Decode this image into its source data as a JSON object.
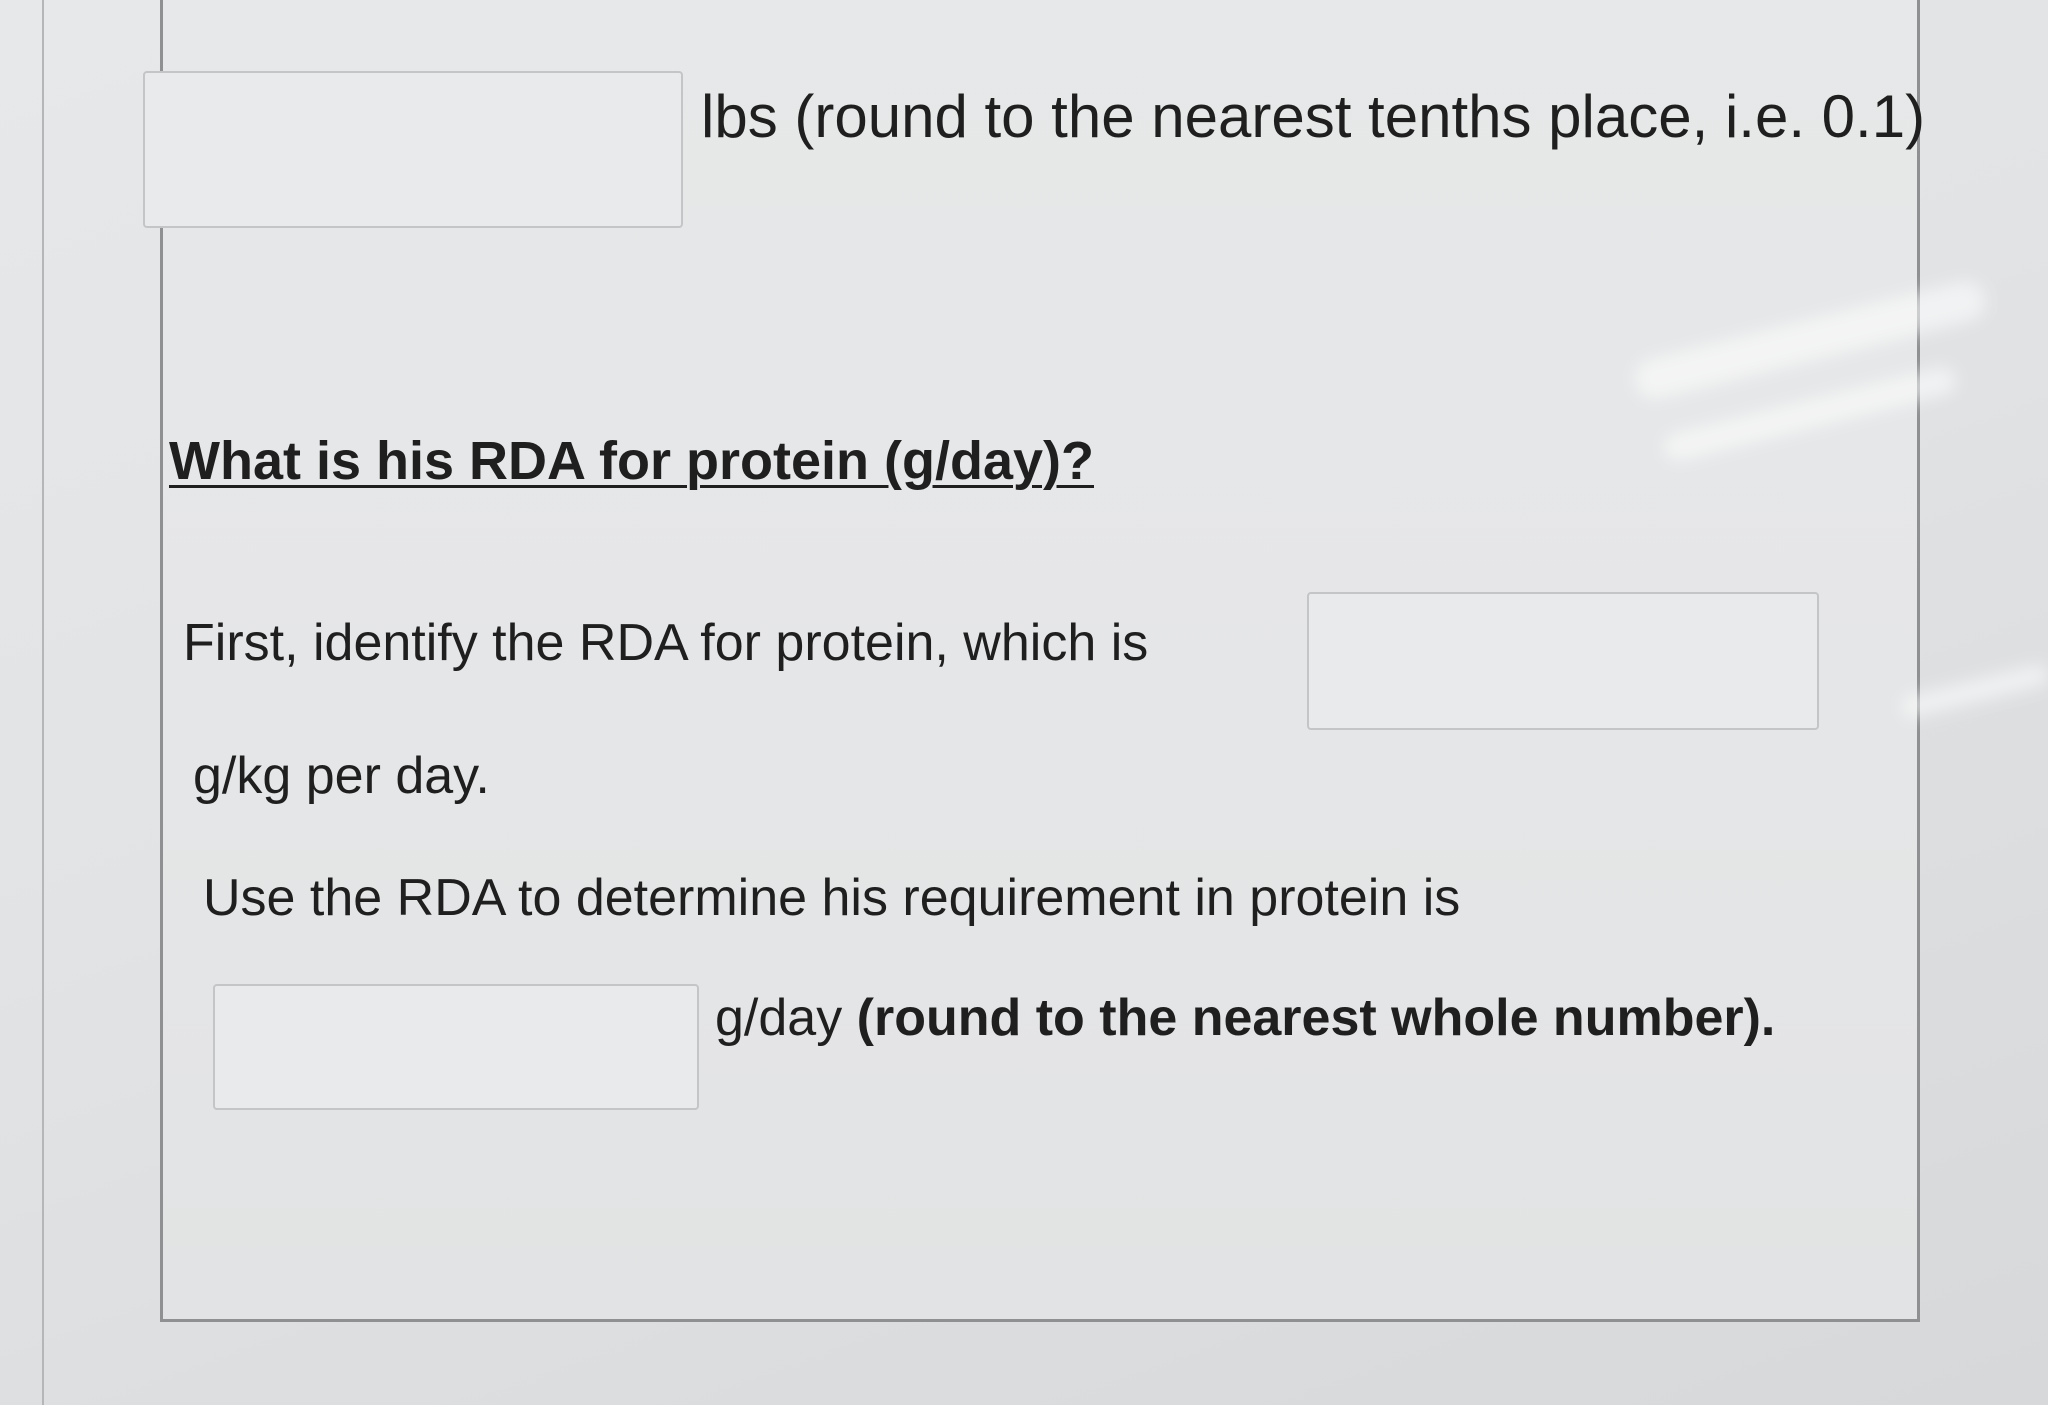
{
  "question_block": {
    "weight_unit_note": "lbs (round to the nearest tenths place, i.e. 0.1)",
    "weight_answer": "",
    "heading": "What is his RDA for protein (g/day)?",
    "step1_prefix": "First, identify the RDA for protein, which is",
    "rda_answer": "",
    "step1_suffix": "g/kg per day.",
    "step2_text": "Use the RDA to determine his requirement in protein is",
    "requirement_answer": "",
    "step2_unit": "g/day",
    "step2_note": "(round to the nearest whole number)."
  }
}
